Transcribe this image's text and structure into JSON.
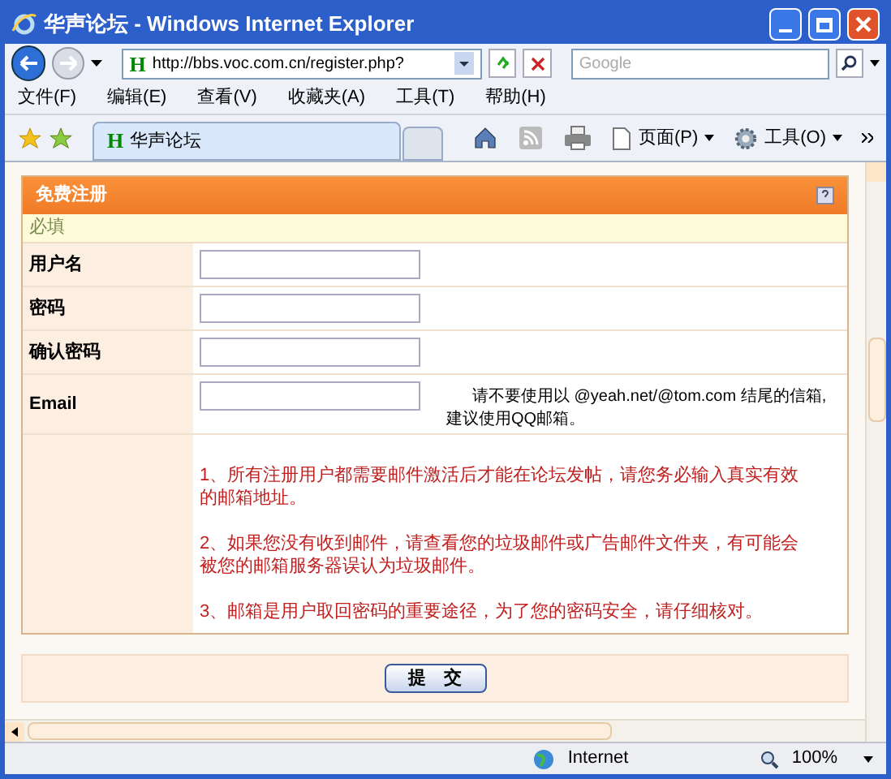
{
  "window": {
    "title": "华声论坛 - Windows Internet Explorer"
  },
  "address_bar": {
    "site_icon": "H",
    "url": "http://bbs.voc.com.cn/register.php?"
  },
  "search": {
    "placeholder": "Google"
  },
  "menu": [
    "文件(F)",
    "编辑(E)",
    "查看(V)",
    "收藏夹(A)",
    "工具(T)",
    "帮助(H)"
  ],
  "tabs": [
    {
      "icon": "H",
      "label": "华声论坛",
      "selected": true
    }
  ],
  "command_bar": [
    {
      "kind": "home"
    },
    {
      "kind": "feed"
    },
    {
      "kind": "print"
    },
    {
      "kind": "page",
      "label": "页面(P)"
    },
    {
      "kind": "tools",
      "label": "工具(O)"
    }
  ],
  "form": {
    "title": "免费注册",
    "section": "必填",
    "fields": [
      {
        "label": "用户名"
      },
      {
        "label": "密码"
      },
      {
        "label": "确认密码"
      },
      {
        "label": "Email",
        "hint": "请不要使用以 @yeah.net/@tom.com 结尾的信箱,建议使用QQ邮箱。"
      }
    ],
    "notes": [
      "1、所有注册用户都需要邮件激活后才能在论坛发帖，请您务必输入真实有效的邮箱地址。",
      "2、如果您没有收到邮件，请查看您的垃圾邮件或广告邮件文件夹，有可能会被您的邮箱服务器误认为垃圾邮件。",
      "3、邮箱是用户取回密码的重要途径，为了您的密码安全，请仔细核对。"
    ],
    "submit": "提　交"
  },
  "status_bar": {
    "zone": "Internet",
    "zoom": "100%"
  }
}
